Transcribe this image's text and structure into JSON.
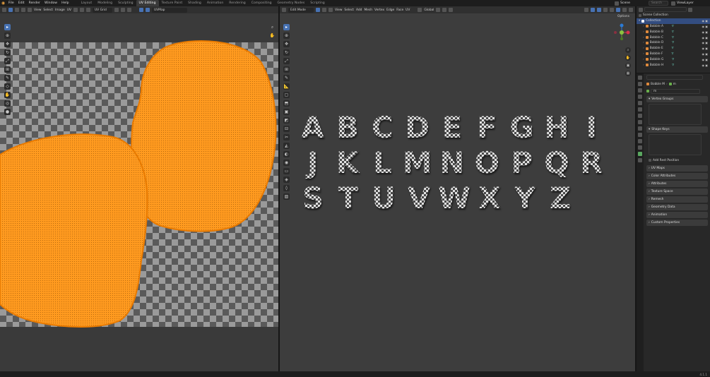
{
  "menu": [
    "File",
    "Edit",
    "Render",
    "Window",
    "Help"
  ],
  "workspaces": [
    {
      "label": "Layout",
      "active": false
    },
    {
      "label": "Modeling",
      "active": false
    },
    {
      "label": "Sculpting",
      "active": false
    },
    {
      "label": "UV Editing",
      "active": true
    },
    {
      "label": "Texture Paint",
      "active": false
    },
    {
      "label": "Shading",
      "active": false
    },
    {
      "label": "Animation",
      "active": false
    },
    {
      "label": "Rendering",
      "active": false
    },
    {
      "label": "Compositing",
      "active": false
    },
    {
      "label": "Geometry Nodes",
      "active": false
    },
    {
      "label": "Scripting",
      "active": false
    }
  ],
  "top_right": {
    "scene": "Scene",
    "view_layer": "ViewLayer",
    "search_placeholder": "Search"
  },
  "uv_header": {
    "menus": [
      "View",
      "Select",
      "Image",
      "UV"
    ],
    "image_name": "UV Grid",
    "uv_map": "UVMap"
  },
  "viewport_header": {
    "mode": "Edit Mode",
    "menus": [
      "View",
      "Select",
      "Add",
      "Mesh",
      "Vertex",
      "Edge",
      "Face",
      "UV"
    ],
    "orientation": "Global",
    "options": "Options"
  },
  "letters": [
    [
      "A",
      "B",
      "C",
      "D",
      "E",
      "F",
      "G",
      "H",
      "I"
    ],
    [
      "J",
      "K",
      "L",
      "M",
      "N",
      "O",
      "P",
      "Q",
      "R"
    ],
    [
      "S",
      "T",
      "U",
      "V",
      "W",
      "X",
      "Y",
      "Z"
    ]
  ],
  "outliner": {
    "title": "Scene Collection",
    "collection": "Collection",
    "items": [
      "Bobble A",
      "Bobble B",
      "Bobble C",
      "Bobble D",
      "Bobble E",
      "Bobble F",
      "Bobble G",
      "Bobble H"
    ]
  },
  "properties": {
    "object_name": "Bobble M",
    "mesh_name": "m",
    "mesh_field": "m",
    "panels": [
      {
        "label": "Vertex Groups",
        "open": true
      },
      {
        "label": "Shape Keys",
        "open": true
      }
    ],
    "add_rest_position": "Add Rest Position",
    "collapsed": [
      "UV Maps",
      "Color Attributes",
      "Attributes",
      "Texture Space",
      "Remesh",
      "Geometry Data",
      "Animation",
      "Custom Properties"
    ]
  },
  "status": {
    "version": "4.1.1"
  },
  "colors": {
    "accent": "#4772b3",
    "uv_orange": "#ff9a1f",
    "uv_edge": "#e87a00",
    "checker_dark": "#5a5a5a",
    "checker_light": "#9a9a9a"
  }
}
